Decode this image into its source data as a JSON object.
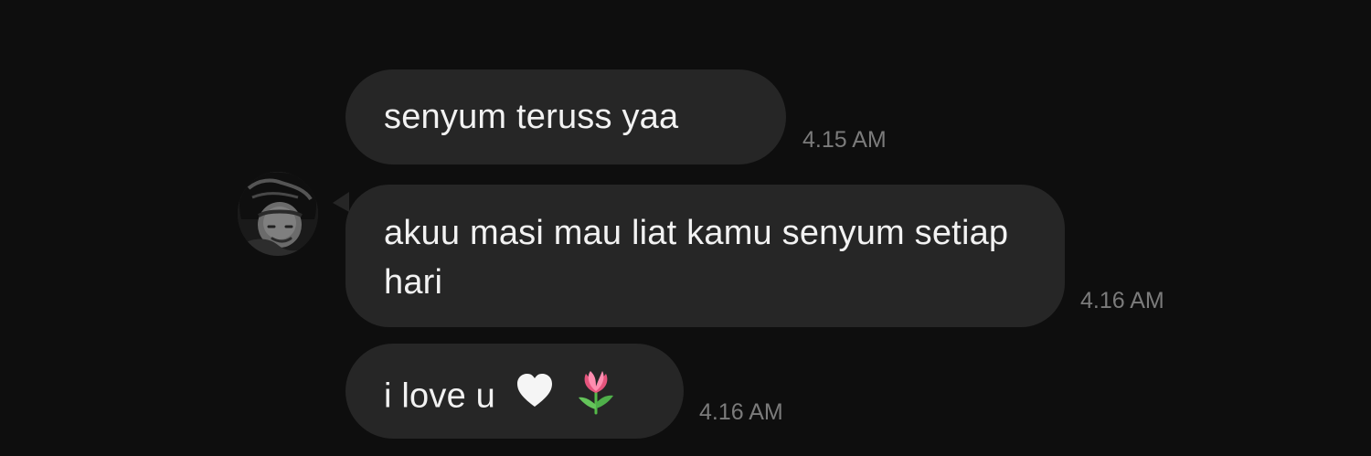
{
  "conversation": {
    "messages": [
      {
        "text": "senyum teruss yaa",
        "time": "4.15 AM"
      },
      {
        "text": "akuu masi mau liat kamu senyum setiap hari",
        "time": "4.16 AM"
      },
      {
        "text": "i love u",
        "emoji": [
          "white-heart-icon",
          "tulip-icon"
        ],
        "time": "4.16 AM"
      }
    ]
  },
  "colors": {
    "background": "#0e0e0e",
    "bubble": "#262626",
    "text": "#f2f2f2",
    "timestamp": "#7b7b7b"
  }
}
